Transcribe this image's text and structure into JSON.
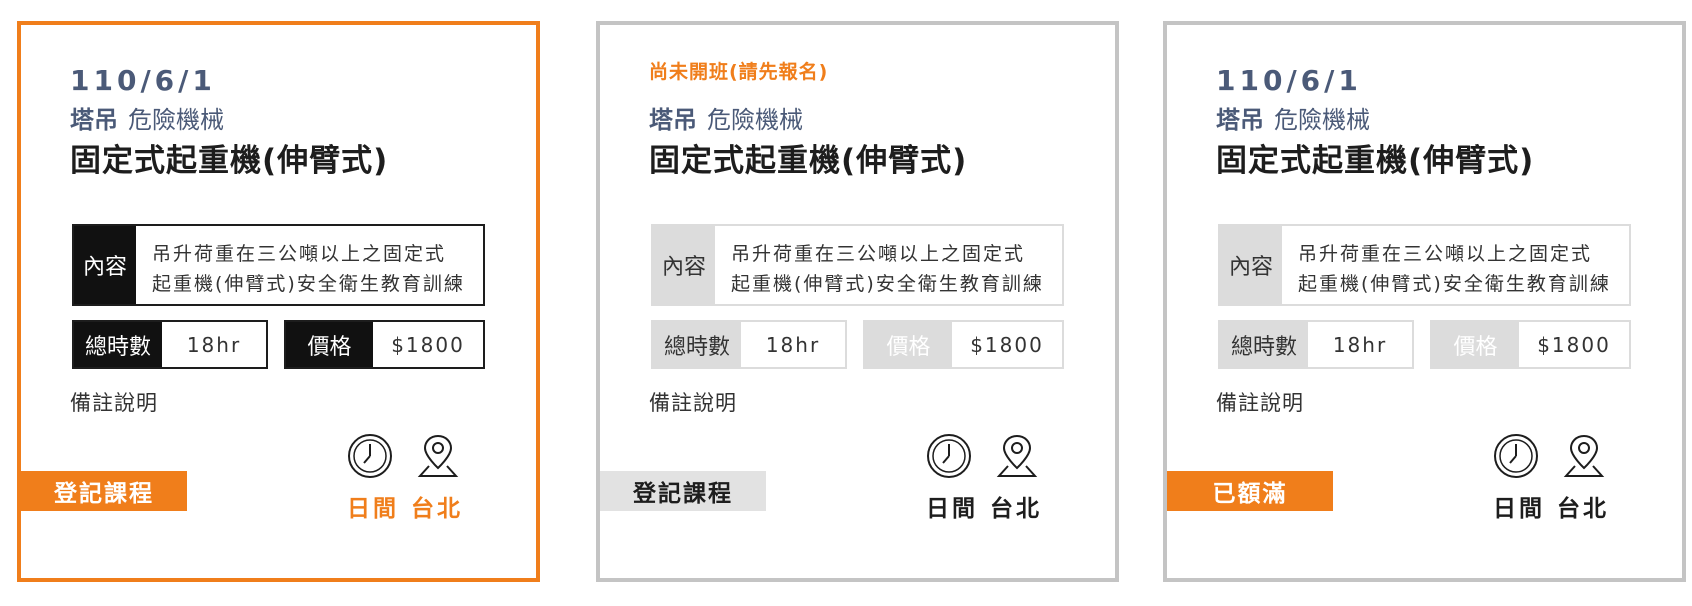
{
  "courses": [
    {
      "date": "110/6/1",
      "notice": "",
      "category_main": "塔吊",
      "category_sub": "危險機械",
      "title": "固定式起重機(伸臂式)",
      "desc_label": "內容",
      "desc_line1": "吊升荷重在三公噸以上之固定式",
      "desc_line2": "起重機(伸臂式)安全衛生教育訓練",
      "hours_label": "總時數",
      "hours_value": "18hr",
      "price_label": "價格",
      "price_value": "$1800",
      "remark": "備註說明",
      "button_label": "登記課程",
      "time_label": "日間",
      "location_label": "台北",
      "style": "selected"
    },
    {
      "date": "",
      "notice": "尚未開班(請先報名)",
      "category_main": "塔吊",
      "category_sub": "危險機械",
      "title": "固定式起重機(伸臂式)",
      "desc_label": "內容",
      "desc_line1": "吊升荷重在三公噸以上之固定式",
      "desc_line2": "起重機(伸臂式)安全衛生教育訓練",
      "hours_label": "總時數",
      "hours_value": "18hr",
      "price_label": "價格",
      "price_value": "$1800",
      "remark": "備註說明",
      "button_label": "登記課程",
      "time_label": "日間",
      "location_label": "台北",
      "style": "unscheduled"
    },
    {
      "date": "110/6/1",
      "notice": "",
      "category_main": "塔吊",
      "category_sub": "危險機械",
      "title": "固定式起重機(伸臂式)",
      "desc_label": "內容",
      "desc_line1": "吊升荷重在三公噸以上之固定式",
      "desc_line2": "起重機(伸臂式)安全衛生教育訓練",
      "hours_label": "總時數",
      "hours_value": "18hr",
      "price_label": "價格",
      "price_value": "$1800",
      "remark": "備註說明",
      "button_label": "已額滿",
      "time_label": "日間",
      "location_label": "台北",
      "style": "full"
    }
  ],
  "colors": {
    "accent": "#f07e1b",
    "heading_blue": "#4b5a78",
    "border_grey": "#c4c4c4"
  },
  "icons": [
    "clock-icon",
    "location-pin-icon"
  ]
}
